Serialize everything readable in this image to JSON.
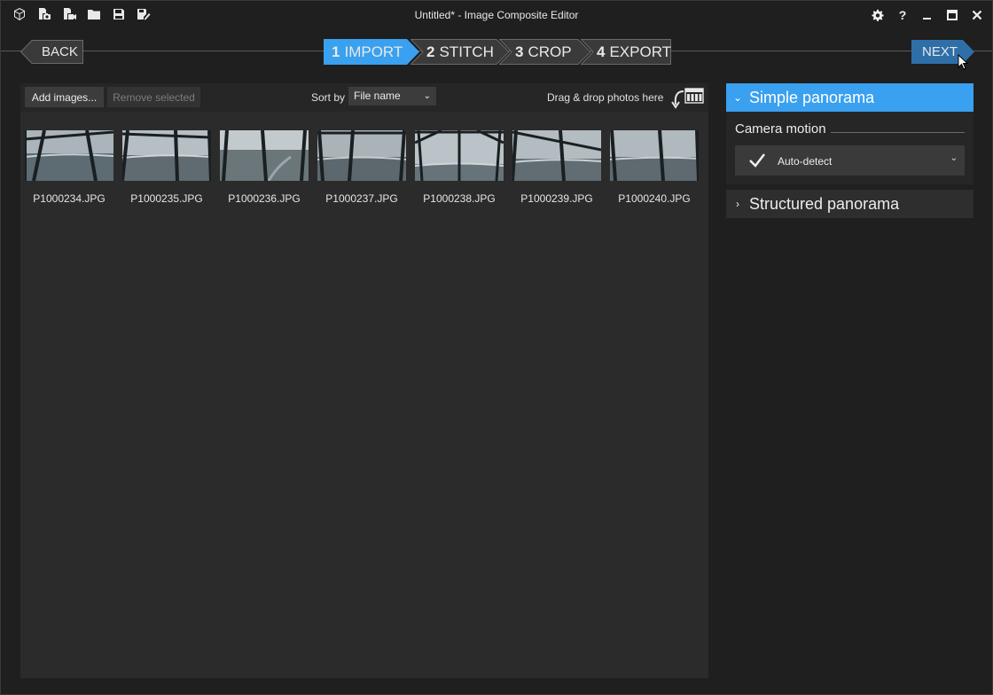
{
  "window": {
    "title": "Untitled* - Image Composite Editor"
  },
  "titlebar_icons": [
    "new-project-icon",
    "new-panorama-from-images-icon",
    "new-panorama-from-video-icon",
    "open-folder-icon",
    "save-icon",
    "save-as-icon"
  ],
  "window_controls": [
    "settings-icon",
    "help-icon",
    "minimize-icon",
    "maximize-icon",
    "close-icon"
  ],
  "wizard": {
    "back_label": "BACK",
    "next_label": "NEXT",
    "steps": [
      {
        "num": "1",
        "label": "IMPORT",
        "active": true
      },
      {
        "num": "2",
        "label": "STITCH",
        "active": false
      },
      {
        "num": "3",
        "label": "CROP",
        "active": false
      },
      {
        "num": "4",
        "label": "EXPORT",
        "active": false
      }
    ],
    "active_color": "#3aa0f0"
  },
  "toolbar": {
    "add_images_label": "Add images...",
    "remove_selected_label": "Remove selected",
    "sort_by_label": "Sort by",
    "sort_by_value": "File name",
    "drag_drop_label": "Drag & drop photos here"
  },
  "images": [
    {
      "name": "P1000234.JPG"
    },
    {
      "name": "P1000235.JPG"
    },
    {
      "name": "P1000236.JPG"
    },
    {
      "name": "P1000237.JPG"
    },
    {
      "name": "P1000238.JPG"
    },
    {
      "name": "P1000239.JPG"
    },
    {
      "name": "P1000240.JPG"
    }
  ],
  "right_panel": {
    "simple_panorama_label": "Simple panorama",
    "camera_motion_label": "Camera motion",
    "camera_motion_value": "Auto-detect",
    "structured_panorama_label": "Structured panorama"
  }
}
